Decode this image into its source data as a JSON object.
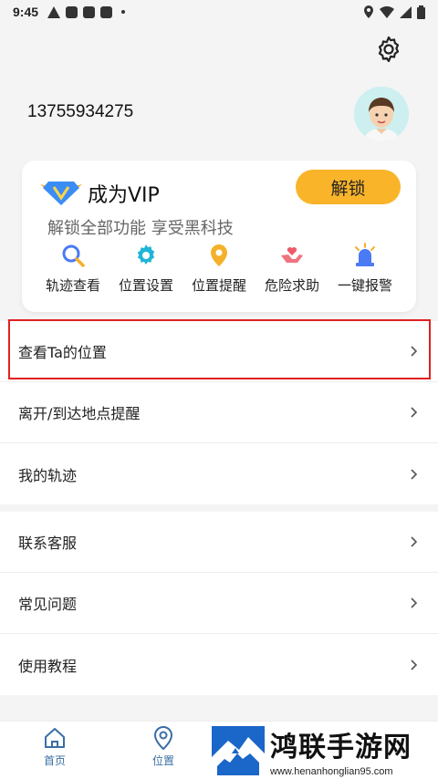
{
  "status_bar": {
    "time": "9:45"
  },
  "account": {
    "phone": "13755934275"
  },
  "vip": {
    "title": "成为VIP",
    "unlock_label": "解锁",
    "subtitle": "解锁全部功能 享受黑科技",
    "features": [
      {
        "label": "轨迹查看",
        "icon": "search-icon",
        "color": "#4a7bf5"
      },
      {
        "label": "位置设置",
        "icon": "gear-icon",
        "color": "#1fb5d6"
      },
      {
        "label": "位置提醒",
        "icon": "location-pin-icon",
        "color": "#f5b02a"
      },
      {
        "label": "危险求助",
        "icon": "helping-hands-icon",
        "color": "#ee5a6a"
      },
      {
        "label": "一键报警",
        "icon": "alarm-light-icon",
        "color": "#4a7bf5"
      }
    ]
  },
  "menu_group_1": [
    {
      "label": "查看Ta的位置"
    },
    {
      "label": "离开/到达地点提醒"
    },
    {
      "label": "我的轨迹"
    }
  ],
  "menu_group_2": [
    {
      "label": "联系客服"
    },
    {
      "label": "常见问题"
    },
    {
      "label": "使用教程"
    }
  ],
  "tabbar": {
    "tabs": [
      {
        "label": "首页",
        "icon": "home-icon"
      },
      {
        "label": "位置",
        "icon": "location-icon"
      }
    ]
  },
  "watermark": {
    "title": "鸿联手游网",
    "url": "www.henanhonglian95.com"
  },
  "colors": {
    "accent": "#f9b42a",
    "highlight_border": "#e02020",
    "tab_color": "#3a6ea5"
  }
}
